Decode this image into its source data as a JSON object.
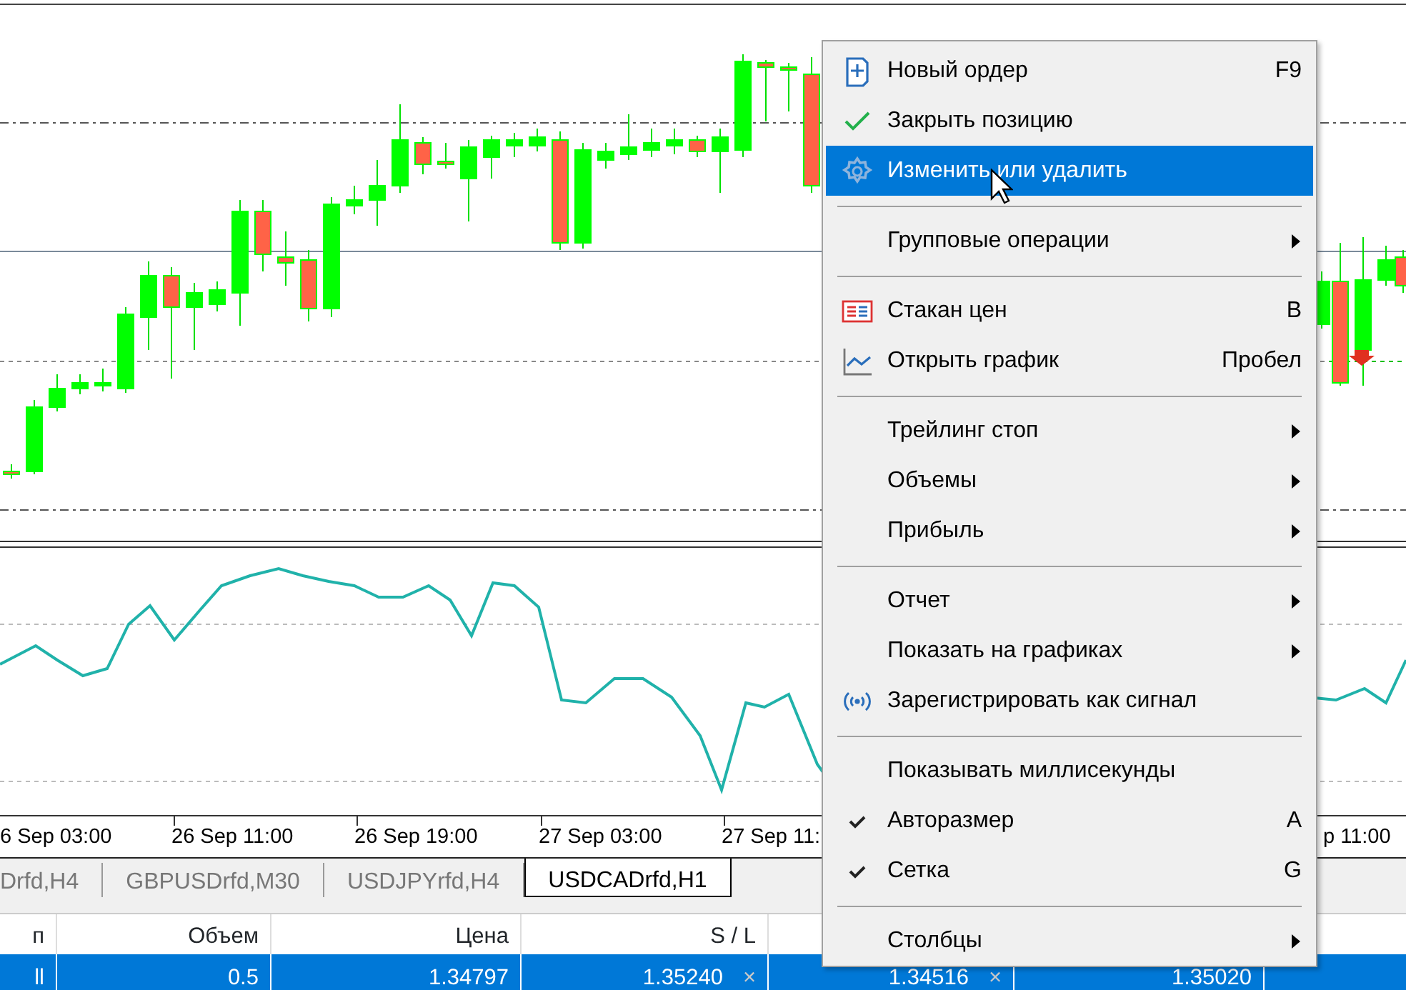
{
  "chart": {
    "time_labels": [
      "6 Sep 03:00",
      "26 Sep 11:00",
      "26 Sep 19:00",
      "27 Sep 03:00",
      "27 Sep 11:",
      "p 11:00"
    ]
  },
  "tabs": [
    {
      "label": "Drfd,H4",
      "selected": false
    },
    {
      "label": "GBPUSDrfd,M30",
      "selected": false
    },
    {
      "label": "USDJPYrfd,H4",
      "selected": false
    },
    {
      "label": "USDCADrfd,H1",
      "selected": true
    }
  ],
  "table": {
    "columns": [
      "п",
      "Объем",
      "Цена",
      "S / L"
    ],
    "rows": [
      {
        "selected": true,
        "cells": [
          {
            "text": "ll"
          },
          {
            "text": "0.5"
          },
          {
            "text": "1.34797"
          },
          {
            "text": "1.35240",
            "clear": "×"
          },
          {
            "text": "1.34516",
            "clear": "×"
          },
          {
            "text": "1.35020"
          }
        ]
      }
    ]
  },
  "context_menu": [
    {
      "kind": "item",
      "label": "Новый ордер",
      "shortcut": "F9",
      "submenu": false,
      "selected": false
    },
    {
      "kind": "item",
      "label": "Закрыть позицию",
      "submenu": false,
      "selected": false
    },
    {
      "kind": "item",
      "label": "Изменить или удалить",
      "submenu": false,
      "selected": true
    },
    {
      "kind": "separator"
    },
    {
      "kind": "item",
      "label": "Групповые операции",
      "submenu": true,
      "selected": false
    },
    {
      "kind": "separator"
    },
    {
      "kind": "item",
      "label": "Стакан цен",
      "shortcut": "B",
      "submenu": false,
      "selected": false
    },
    {
      "kind": "item",
      "label": "Открыть график",
      "shortcut": "Пробел",
      "submenu": false,
      "selected": false
    },
    {
      "kind": "separator"
    },
    {
      "kind": "item",
      "label": "Трейлинг стоп",
      "submenu": true,
      "selected": false
    },
    {
      "kind": "item",
      "label": "Объемы",
      "submenu": true,
      "selected": false
    },
    {
      "kind": "item",
      "label": "Прибыль",
      "submenu": true,
      "selected": false
    },
    {
      "kind": "separator"
    },
    {
      "kind": "item",
      "label": "Отчет",
      "submenu": true,
      "selected": false
    },
    {
      "kind": "item",
      "label": "Показать на графиках",
      "submenu": true,
      "selected": false
    },
    {
      "kind": "item",
      "label": "Зарегистрировать как сигнал",
      "submenu": false,
      "selected": false
    },
    {
      "kind": "separator"
    },
    {
      "kind": "item",
      "label": "Показывать миллисекунды",
      "submenu": false,
      "checked": false,
      "selected": false
    },
    {
      "kind": "item",
      "label": "Авторазмер",
      "shortcut": "A",
      "submenu": false,
      "checked": true,
      "selected": false
    },
    {
      "kind": "item",
      "label": "Сетка",
      "shortcut": "G",
      "submenu": false,
      "checked": true,
      "selected": false
    },
    {
      "kind": "separator"
    },
    {
      "kind": "item",
      "label": "Столбцы",
      "submenu": true,
      "selected": false
    }
  ]
}
